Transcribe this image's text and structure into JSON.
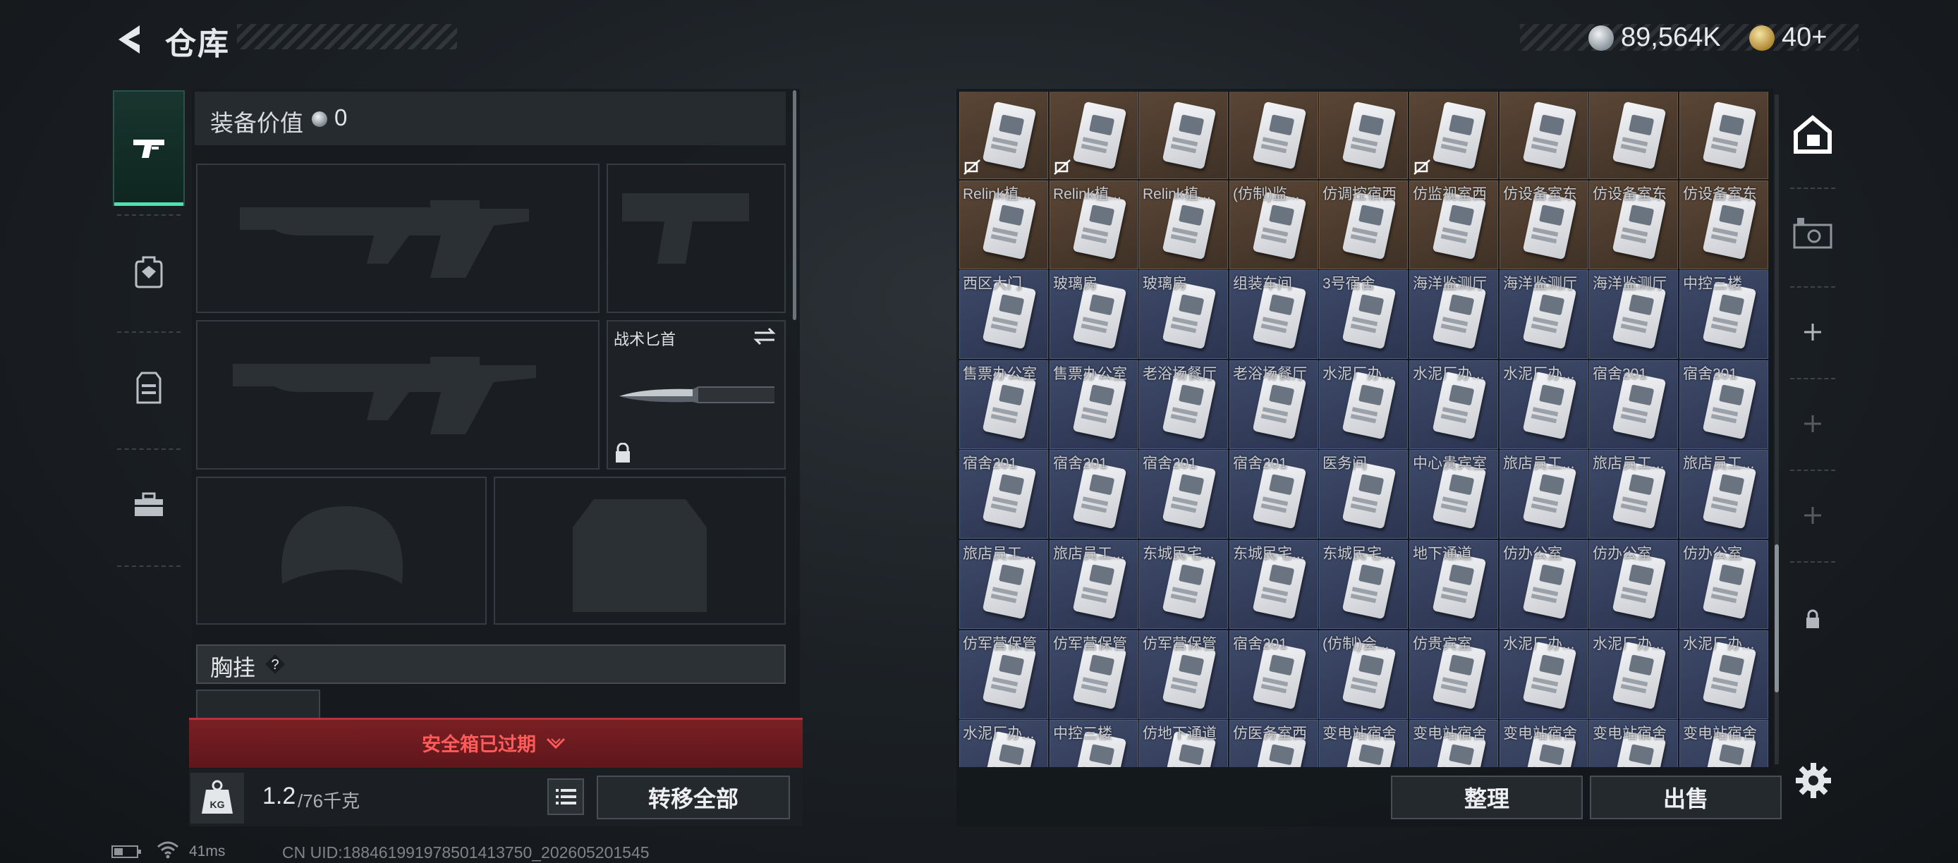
{
  "header": {
    "title": "仓库",
    "money": "89,564K",
    "gold": "40+"
  },
  "colors": {
    "accent": "#52e0b0",
    "alert": "#b8323a",
    "alert_text": "#ff5b5b"
  },
  "tabs": [
    {
      "name": "gun-icon",
      "active": true
    },
    {
      "name": "backpack-icon",
      "active": false
    },
    {
      "name": "vest-icon",
      "active": false
    },
    {
      "name": "toolbox-icon",
      "active": false
    }
  ],
  "equipment": {
    "value_label": "装备价值",
    "value": "0",
    "melee_label": "战术匕首",
    "chest_rig_label": "胸挂",
    "help_symbol": "?",
    "safe_box_expired": "安全箱已过期",
    "weight_current": "1.2",
    "weight_max": "/76千克",
    "weight_icon_text": "KG",
    "transfer_all": "转移全部"
  },
  "stash": {
    "sort_label": "整理",
    "sell_label": "出售",
    "rows": [
      [
        "",
        "",
        "",
        "",
        "",
        "",
        "",
        "",
        ""
      ],
      [
        "Relink植...",
        "Relink植...",
        "Relink植...",
        "(仿制)监...",
        "仿调控宿西",
        "仿监视室西",
        "仿设备室东",
        "仿设备室东",
        "仿设备室东"
      ],
      [
        "西区大门",
        "玻璃房",
        "玻璃房",
        "组装车间",
        "3号宿舍",
        "海洋监测厅",
        "海洋监测厅",
        "海洋监测厅",
        "中控三楼"
      ],
      [
        "售票办公室",
        "售票办公室",
        "老浴场餐厅",
        "老浴场餐厅",
        "水泥厂办...",
        "水泥厂办...",
        "水泥厂办...",
        "宿舍201",
        "宿舍201"
      ],
      [
        "宿舍201",
        "宿舍201",
        "宿舍201",
        "宿舍201",
        "医务间",
        "中心贵宾室",
        "旅店员工...",
        "旅店员工...",
        "旅店员工..."
      ],
      [
        "旅店员工...",
        "旅店员工...",
        "东城民宅...",
        "东城民宅...",
        "东城民宅...",
        "地下通道",
        "仿办公室",
        "仿办公室",
        "仿办公室"
      ],
      [
        "仿军营保管",
        "仿军营保管",
        "仿军营保管",
        "宿舍201",
        "(仿制)会...",
        "仿贵宾室",
        "水泥厂办...",
        "水泥厂办...",
        "水泥厂办..."
      ],
      [
        "水泥厂办...",
        "中控三楼",
        "仿地下通道",
        "仿医务室西",
        "变电站宿舍",
        "变电站宿舍",
        "变电站宿舍",
        "变电站宿舍",
        "变电站宿舍"
      ]
    ]
  },
  "rail": [
    "house-icon",
    "card-reader-icon",
    "plus-icon",
    "plus-icon",
    "plus-icon",
    "lock-icon"
  ],
  "footer": {
    "ping": "41ms",
    "uid": "CN UID:18846199197850141​3750_202605201545"
  }
}
